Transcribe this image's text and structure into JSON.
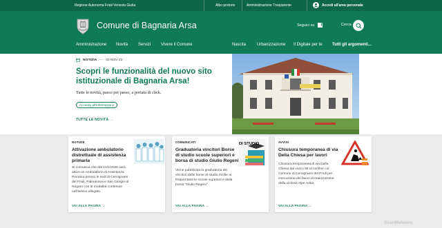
{
  "topbar": {
    "region": "Regione Autonoma Friuli Venezia Giulia",
    "albo": "Albo pretorio",
    "trasparente": "Amministrazione Trasparente",
    "account": "Accedi all'area personale"
  },
  "header": {
    "title": "Comune di Bagnaria Arsa",
    "follow": "Seguici su",
    "search": "Cerca"
  },
  "nav": {
    "items": [
      "Amministrazione",
      "Novità",
      "Servizi",
      "Vivere il Comune"
    ],
    "right_items": [
      "Nascita",
      "Urbanizzazione",
      "Il Digitale per te",
      "Tutti gli argomenti..."
    ]
  },
  "hero": {
    "type": "NOTIZIA",
    "date": "03 NOV 23",
    "title": "Scopri le funzionalità del nuovo sito istituzionale di Bagnaria Arsa!",
    "desc": "Tutte le novità, passo per passo, a portata di click.",
    "chip": "Accesso all'informazione",
    "link": "TUTTE LE NOVITÀ"
  },
  "cards": [
    {
      "category": "NOTIZIE",
      "title": "Attivazione ambulatorio distrettuale di assistenza primaria",
      "desc": [
        "Si comunica che dal 12/1/2026 sarà",
        "attivo un Ambulatorio di Assistenza",
        "Primaria presso le sedi di Cervignano",
        "del Friuli, Palmanova e San Giorgio di",
        "Nogaro con le modalità contenute",
        "nell'avviso allegato."
      ],
      "more": "VAI ALLA PAGINA"
    },
    {
      "category": "COMUNICATI",
      "title": "Graduatoria vincitori Borse di studio scuole superiori e borsa di studio Giulio Regeni",
      "desc": [
        "Viene pubblicata la graduatoria dei",
        "vincitori delle borse di studio rivolte ai",
        "frequentanti le scuole superiori e della",
        "borsa \"Giulio Regeni\""
      ],
      "thumb_text": "DI STUDIO",
      "more": "VAI ALLA PAGINA"
    },
    {
      "category": "AVVISI",
      "title": "Chiusura temporanea di via Della Chiesa per lavori",
      "desc": [
        "Chiusura temporanea di via Della",
        "Chiesa dal civico 35 al confine col",
        "Comune di Cervignano del Friuli per",
        "esecuzione dei lavori di realizzazione",
        "della ciclovia Alpe Adria"
      ],
      "more": "VAI ALLA PAGINA"
    }
  ],
  "watermark": "ScanMalware",
  "colors": {
    "primary": "#0f7a55",
    "topbar": "#0d6648",
    "band": "#eaebec"
  }
}
